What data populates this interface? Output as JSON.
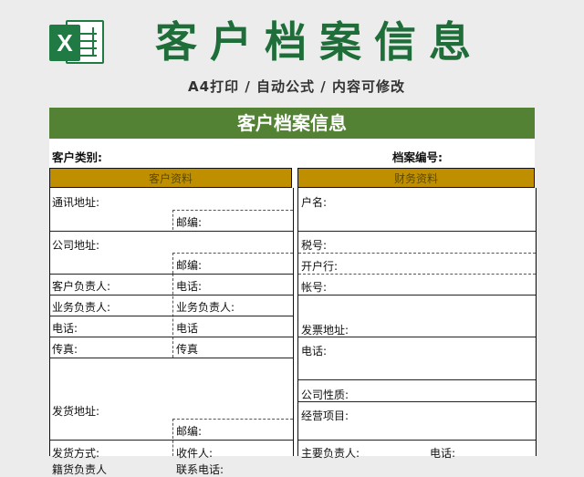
{
  "banner": {
    "title": "客户档案信息",
    "subtitle": "A4打印 / 自动公式 / 内容可修改",
    "logo_letter": "X"
  },
  "sheet": {
    "header": "客户档案信息",
    "customer_type_label": "客户类别:",
    "file_number_label": "档案编号:",
    "left_section": "客户资料",
    "right_section": "财务资料",
    "left": {
      "address_1": "通讯地址:",
      "postcode_1": "邮编:",
      "company_address": "公司地址:",
      "postcode_2": "邮编:",
      "customer_manager": "客户负责人:",
      "phone_1": "电话:",
      "sales_manager_1": "业务负责人:",
      "sales_manager_2": "业务负责人:",
      "phone_2": "电话:",
      "phone_3": "电话",
      "fax_1": "传真:",
      "fax_2": "传真",
      "delivery_address": "发货地址:",
      "postcode_3": "邮编:",
      "delivery_method": "发货方式:",
      "receiver": "收件人:",
      "partial_1": "籍货负责人",
      "partial_2": "联系电话:"
    },
    "right": {
      "account_name": "户名:",
      "tax_number": "税号:",
      "bank": "开户行:",
      "account_number": "帐号:",
      "invoice_address": "发票地址:",
      "phone": "电话:",
      "company_nature": "公司性质:",
      "business_scope": "经营项目:",
      "main_manager": "主要负责人:",
      "main_phone": "电话:"
    }
  },
  "colors": {
    "brand_green": "#1f7a44",
    "header_green": "#548235",
    "section_gold": "#bf8f00"
  }
}
